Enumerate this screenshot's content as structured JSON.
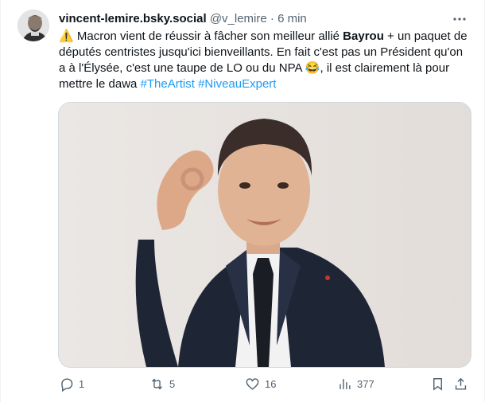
{
  "tweet": {
    "display_name": "vincent-lemire.bsky.social",
    "handle": "@v_lemire",
    "separator": "·",
    "time": "6 min",
    "text": {
      "warning_emoji": "⚠️",
      "part1": " Macron vient de réussir à fâcher son meilleur allié ",
      "bold": "Bayrou",
      "part2": " + un paquet de députés centristes jusqu'ici bienveillants. En fait c'est pas un Président qu'on a à l'Élysée, c'est une taupe de LO ou du NPA ",
      "laugh_emoji": "😂",
      "part3": ", il est clairement là pour mettre le dawa ",
      "hashtag1": "#TheArtist",
      "hashtag2": "#NiveauExpert"
    }
  },
  "actions": {
    "replies": "1",
    "reposts": "5",
    "likes": "16",
    "views": "377"
  },
  "colors": {
    "text": "#0f1419",
    "secondary": "#536471",
    "accent": "#1d9bf0",
    "repost_green": "#00ba7c",
    "border": "#cfd9de"
  },
  "icons": [
    "more-icon",
    "reply-icon",
    "repost-icon",
    "like-icon",
    "views-icon",
    "bookmark-icon",
    "share-icon"
  ]
}
